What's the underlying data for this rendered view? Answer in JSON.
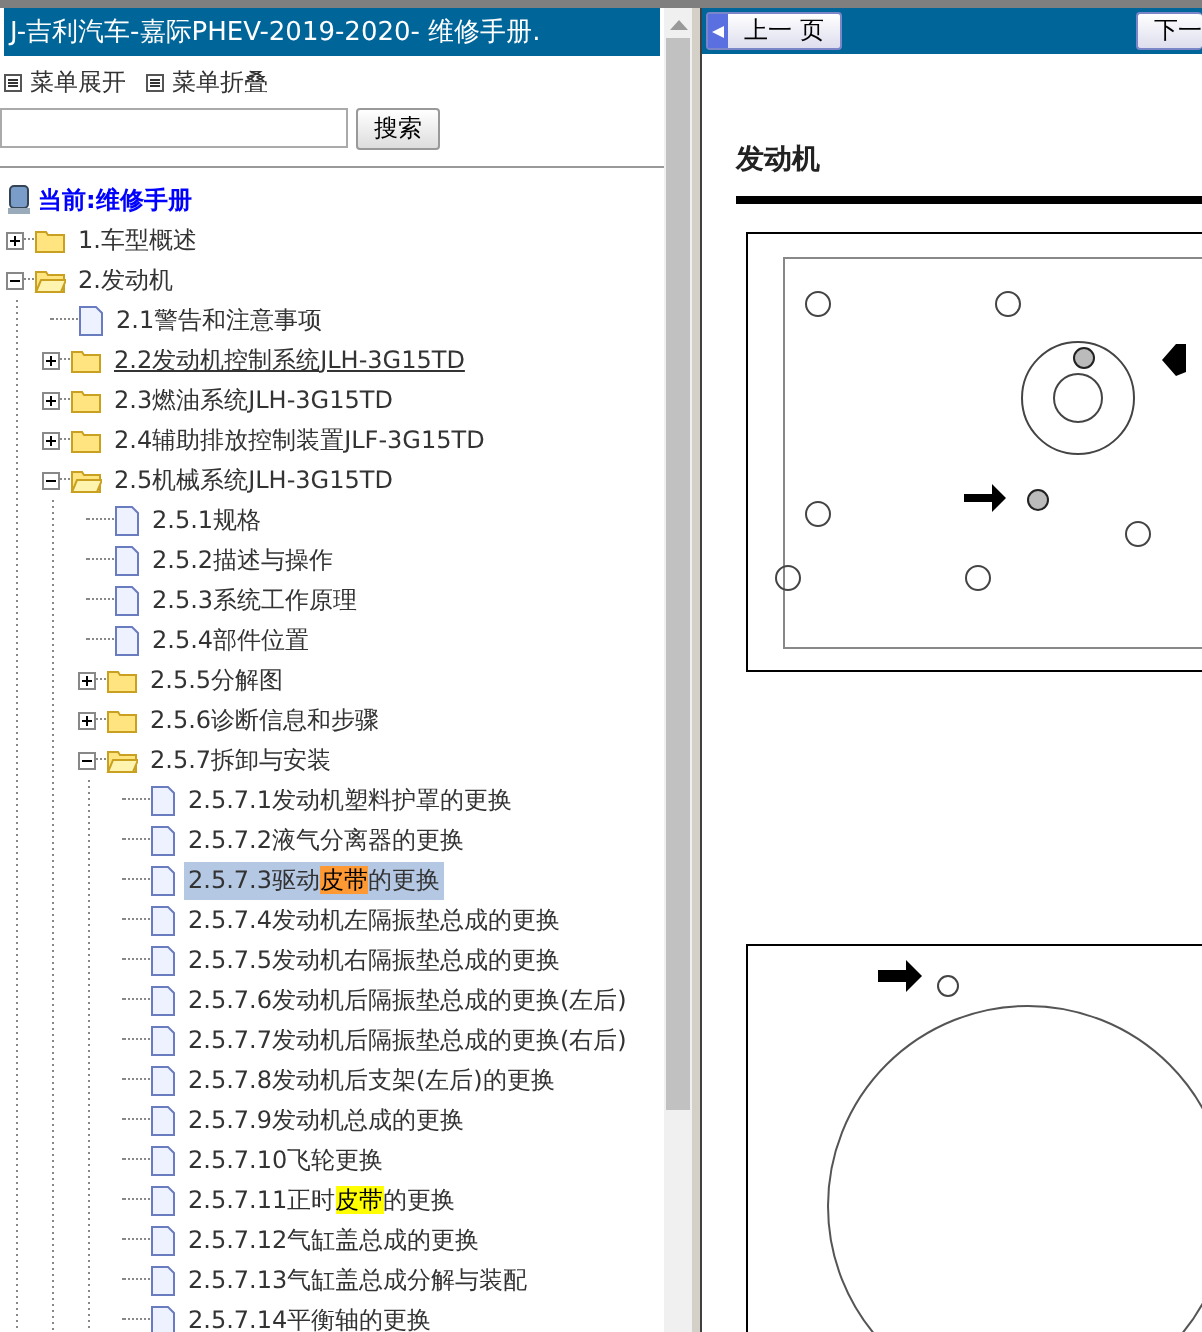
{
  "title": "J-吉利汽车-嘉际PHEV-2019-2020- 维修手册.",
  "menu_links": [
    {
      "label": "菜单展开"
    },
    {
      "label": "菜单折叠"
    }
  ],
  "search": {
    "button": "搜索"
  },
  "tree": {
    "root": "当前:维修手册",
    "items": [
      {
        "kind": "folder",
        "label": [
          {
            "text": "1.车型概述"
          }
        ],
        "expanded": false,
        "selected": false,
        "hovered": false
      },
      {
        "kind": "folder",
        "label": [
          {
            "text": "2.发动机"
          }
        ],
        "expanded": true,
        "selected": false,
        "hovered": false,
        "children": [
          {
            "kind": "page",
            "label": [
              {
                "text": "2.1警告和注意事项"
              }
            ],
            "selected": false,
            "hovered": false
          },
          {
            "kind": "folder",
            "label": [
              {
                "text": "2.2发动机控制系统JLH-3G15TD"
              }
            ],
            "expanded": false,
            "selected": false,
            "hovered": true
          },
          {
            "kind": "folder",
            "label": [
              {
                "text": "2.3燃油系统JLH-3G15TD"
              }
            ],
            "expanded": false,
            "selected": false,
            "hovered": false
          },
          {
            "kind": "folder",
            "label": [
              {
                "text": "2.4辅助排放控制装置JLF-3G15TD"
              }
            ],
            "expanded": false,
            "selected": false,
            "hovered": false
          },
          {
            "kind": "folder",
            "label": [
              {
                "text": "2.5机械系统JLH-3G15TD"
              }
            ],
            "expanded": true,
            "selected": false,
            "hovered": false,
            "children": [
              {
                "kind": "page",
                "label": [
                  {
                    "text": "2.5.1规格"
                  }
                ],
                "selected": false,
                "hovered": false
              },
              {
                "kind": "page",
                "label": [
                  {
                    "text": "2.5.2描述与操作"
                  }
                ],
                "selected": false,
                "hovered": false
              },
              {
                "kind": "page",
                "label": [
                  {
                    "text": "2.5.3系统工作原理"
                  }
                ],
                "selected": false,
                "hovered": false
              },
              {
                "kind": "page",
                "label": [
                  {
                    "text": "2.5.4部件位置"
                  }
                ],
                "selected": false,
                "hovered": false
              },
              {
                "kind": "folder",
                "label": [
                  {
                    "text": "2.5.5分解图"
                  }
                ],
                "expanded": false,
                "selected": false,
                "hovered": false
              },
              {
                "kind": "folder",
                "label": [
                  {
                    "text": "2.5.6诊断信息和步骤"
                  }
                ],
                "expanded": false,
                "selected": false,
                "hovered": false
              },
              {
                "kind": "folder",
                "label": [
                  {
                    "text": "2.5.7拆卸与安装"
                  }
                ],
                "expanded": true,
                "selected": false,
                "hovered": false,
                "children": [
                  {
                    "kind": "page",
                    "label": [
                      {
                        "text": "2.5.7.1发动机塑料护罩的更换"
                      }
                    ],
                    "selected": false,
                    "hovered": false
                  },
                  {
                    "kind": "page",
                    "label": [
                      {
                        "text": "2.5.7.2液气分离器的更换"
                      }
                    ],
                    "selected": false,
                    "hovered": false
                  },
                  {
                    "kind": "page",
                    "label": [
                      {
                        "text": "2.5.7.3驱动"
                      },
                      {
                        "text": "皮带",
                        "color": "#ff9933"
                      },
                      {
                        "text": "的更换"
                      }
                    ],
                    "selected": true,
                    "hovered": false
                  },
                  {
                    "kind": "page",
                    "label": [
                      {
                        "text": "2.5.7.4发动机左隔振垫总成的更换"
                      }
                    ],
                    "selected": false,
                    "hovered": false
                  },
                  {
                    "kind": "page",
                    "label": [
                      {
                        "text": "2.5.7.5发动机右隔振垫总成的更换"
                      }
                    ],
                    "selected": false,
                    "hovered": false
                  },
                  {
                    "kind": "page",
                    "label": [
                      {
                        "text": "2.5.7.6发动机后隔振垫总成的更换(左后)"
                      }
                    ],
                    "selected": false,
                    "hovered": false
                  },
                  {
                    "kind": "page",
                    "label": [
                      {
                        "text": "2.5.7.7发动机后隔振垫总成的更换(右后)"
                      }
                    ],
                    "selected": false,
                    "hovered": false
                  },
                  {
                    "kind": "page",
                    "label": [
                      {
                        "text": "2.5.7.8发动机后支架(左后)的更换"
                      }
                    ],
                    "selected": false,
                    "hovered": false
                  },
                  {
                    "kind": "page",
                    "label": [
                      {
                        "text": "2.5.7.9发动机总成的更换"
                      }
                    ],
                    "selected": false,
                    "hovered": false
                  },
                  {
                    "kind": "page",
                    "label": [
                      {
                        "text": "2.5.7.10飞轮更换"
                      }
                    ],
                    "selected": false,
                    "hovered": false
                  },
                  {
                    "kind": "page",
                    "label": [
                      {
                        "text": "2.5.7.11正时"
                      },
                      {
                        "text": "皮带",
                        "color": "#ffff00"
                      },
                      {
                        "text": "的更换"
                      }
                    ],
                    "selected": false,
                    "hovered": false
                  },
                  {
                    "kind": "page",
                    "label": [
                      {
                        "text": "2.5.7.12气缸盖总成的更换"
                      }
                    ],
                    "selected": false,
                    "hovered": false
                  },
                  {
                    "kind": "page",
                    "label": [
                      {
                        "text": "2.5.7.13气缸盖总成分解与装配"
                      }
                    ],
                    "selected": false,
                    "hovered": false
                  },
                  {
                    "kind": "page",
                    "label": [
                      {
                        "text": "2.5.7.14平衡轴的更换"
                      }
                    ],
                    "selected": false,
                    "hovered": false
                  }
                ]
              }
            ]
          }
        ]
      }
    ]
  },
  "viewer": {
    "prev_button": "上一 页",
    "next_button": "下一",
    "heading": "发动机"
  }
}
